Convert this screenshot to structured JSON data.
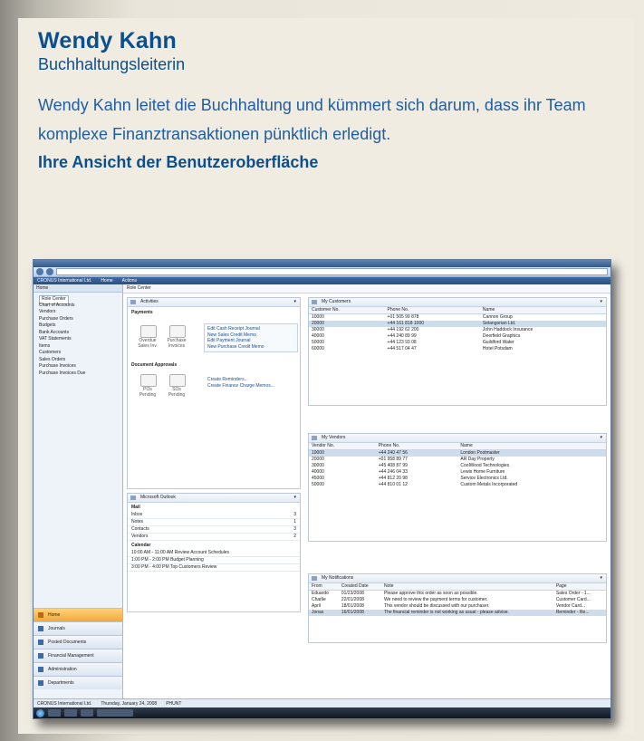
{
  "header": {
    "name": "Wendy Kahn",
    "role": "Buchhaltungsleiterin",
    "description": "Wendy Kahn leitet die Buchhaltung und kümmert sich darum, dass ihr Team komplexe Finanztransaktionen pünktlich erledigt.",
    "subheading": "Ihre Ansicht der Benutzeroberfläche"
  },
  "app": {
    "menu": [
      "CRONUS International Ltd.",
      "Home",
      "Actions"
    ],
    "nav_title": "Home",
    "page_title": "Role Center",
    "tree": [
      "Role Center",
      "Chart of Accounts",
      "Vendors",
      "Purchase Orders",
      "Budgets",
      "Bank Accounts",
      "VAT Statements",
      "Items",
      "Customers",
      "Sales Orders",
      "Purchase Invoices",
      "Purchase Invoices Due"
    ],
    "workspaces": [
      "Home",
      "Journals",
      "Posted Documents",
      "Financial Management",
      "Administration",
      "Departments"
    ],
    "activities": {
      "title": "Activities",
      "section1": "Payments",
      "cues1": [
        "Overdue Sales Inv.",
        "Purchase Invoices"
      ],
      "links1": [
        "Edit Cash Receipt Journal",
        "New Sales Credit Memo",
        "Edit Payment Journal",
        "New Purchase Credit Memo"
      ],
      "section2": "Document Approvals",
      "cues2": [
        "POs Pending",
        "SOs Pending"
      ],
      "links2": [
        "Create Reminders...",
        "Create Finance Charge Memos..."
      ]
    },
    "customers": {
      "title": "My Customers",
      "headers": [
        "Customer No.",
        "Phone No.",
        "Name"
      ],
      "rows": [
        [
          "10000",
          "+01 505 99 878",
          "Cannon Group"
        ],
        [
          "20000",
          "+44 161 818 1000",
          "Selangorian Ltd."
        ],
        [
          "30000",
          "+44 192 62 200",
          "John Haddock Insurance"
        ],
        [
          "40000",
          "+44 240 89 99",
          "Deerfield Graphics"
        ],
        [
          "50000",
          "+44 123 93 08",
          "Guildford Water"
        ],
        [
          "60000",
          "+44 517 04 47",
          "Hotel Potsdam"
        ]
      ]
    },
    "vendors": {
      "title": "My Vendors",
      "headers": [
        "Vendor No.",
        "Phone No.",
        "Name"
      ],
      "rows": [
        [
          "10000",
          "+44 240 47 56",
          "London Postmaster"
        ],
        [
          "20000",
          "+01 958 89 77",
          "AR Day Property"
        ],
        [
          "30000",
          "+45 408 87 99",
          "CoolWood Technologies"
        ],
        [
          "40000",
          "+44 246 04 33",
          "Lewis Home Furniture"
        ],
        [
          "45000",
          "+44 812 20 98",
          "Service Electronics Ltd."
        ],
        [
          "50000",
          "+44 810 01 12",
          "Custom Metals Incorporated"
        ]
      ]
    },
    "outlook": {
      "title": "Microsoft Outlook",
      "mail_label": "Mail",
      "mail_rows": [
        [
          "Inbox",
          "3"
        ],
        [
          "Notes",
          "1"
        ],
        [
          "Contacts",
          "3"
        ],
        [
          "Vendors",
          "2"
        ]
      ],
      "calendar_label": "Calendar",
      "calendar_rows": [
        "10:00 AM - 11:00 AM  Review Account Schedules",
        "1:00 PM - 2:00 PM  Budget Planning",
        "3:00 PM - 4:00 PM  Top Customers Review"
      ]
    },
    "notifications": {
      "title": "My Notifications",
      "headers": [
        "From",
        "Created Date",
        "Note",
        "Page"
      ],
      "rows": [
        [
          "Eduardo",
          "01/23/2008",
          "Please approve this order as soon as possible.",
          "Sales Order - 1..."
        ],
        [
          "Charlie",
          "22/01/2008",
          "We need to review the payment terms for customer.",
          "Customer Card..."
        ],
        [
          "April",
          "18/01/2008",
          "This vendor should be discussed with our purchaser.",
          "Vendor Card..."
        ],
        [
          "Jonas",
          "16/01/2008",
          "The financial reminder is not working as usual - please advise.",
          "Reminder - Re..."
        ]
      ]
    },
    "status": {
      "company": "CRONUS International Ltd.",
      "date": "Thursday, January 24, 2008",
      "user": "PHUNT"
    }
  }
}
